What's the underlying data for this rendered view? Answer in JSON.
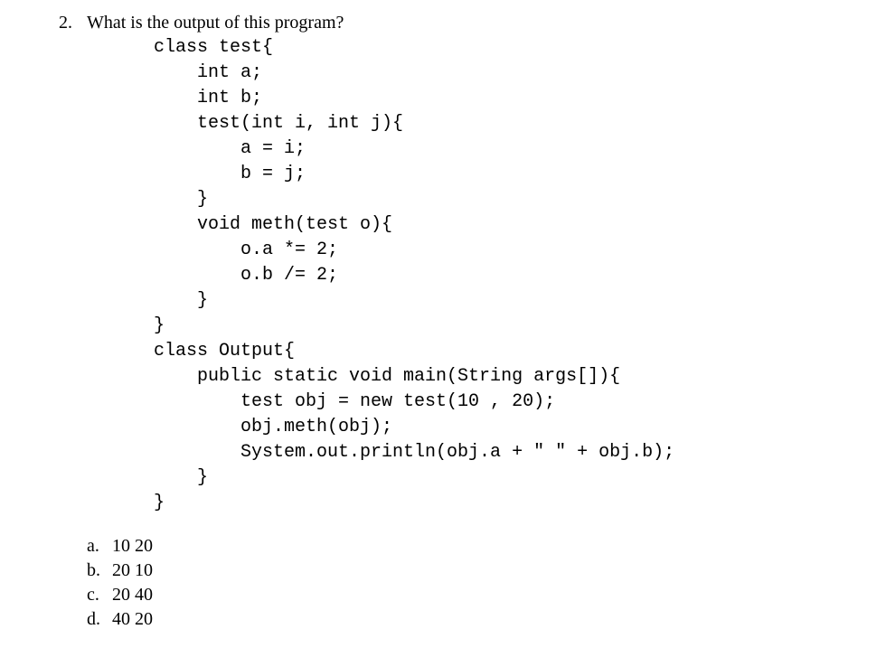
{
  "question": {
    "number": "2.",
    "text": "What is the output of this program?"
  },
  "code": "class test{\n    int a;\n    int b;\n    test(int i, int j){\n        a = i;\n        b = j;\n    }\n    void meth(test o){\n        o.a *= 2;\n        o.b /= 2;\n    }\n}\nclass Output{\n    public static void main(String args[]){\n        test obj = new test(10 , 20);\n        obj.meth(obj);\n        System.out.println(obj.a + \" \" + obj.b);\n    }\n}",
  "options": [
    {
      "letter": "a.",
      "text": "10 20"
    },
    {
      "letter": "b.",
      "text": "20 10"
    },
    {
      "letter": "c.",
      "text": "20 40"
    },
    {
      "letter": "d.",
      "text": "40 20"
    }
  ]
}
